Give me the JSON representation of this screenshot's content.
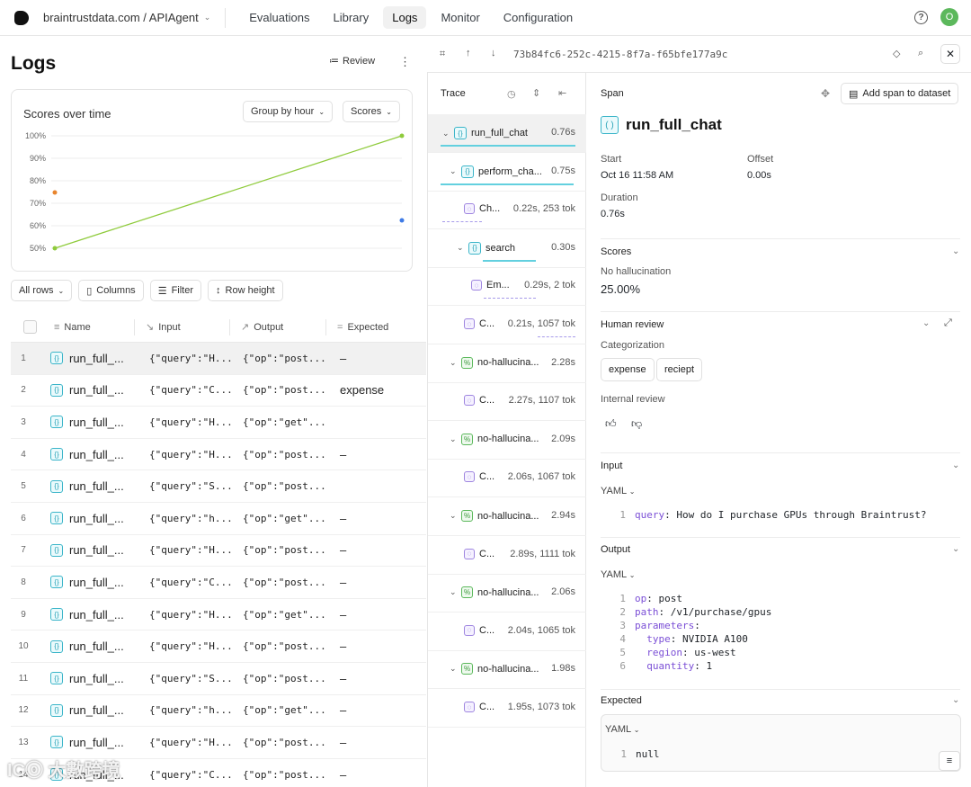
{
  "nav": {
    "project": "braintrustdata.com / APIAgent",
    "tabs": [
      "Evaluations",
      "Library",
      "Logs",
      "Monitor",
      "Configuration"
    ],
    "active_tab": "Logs",
    "avatar_initial": "O"
  },
  "logs": {
    "title": "Logs",
    "review_label": "Review",
    "chart": {
      "title": "Scores over time",
      "group_by": "Group by hour",
      "scores_chip": "Scores",
      "y_ticks": [
        "100%",
        "90%",
        "80%",
        "70%",
        "60%",
        "50%"
      ]
    },
    "toolbar": {
      "all_rows": "All rows",
      "columns": "Columns",
      "filter": "Filter",
      "row_height": "Row height"
    },
    "columns": {
      "name": "Name",
      "input": "Input",
      "output": "Output",
      "expected": "Expected"
    },
    "rows": [
      {
        "idx": "1",
        "name": "run_full_...",
        "input": "{\"query\":\"H...",
        "output": "{\"op\":\"post...",
        "expected": "–"
      },
      {
        "idx": "2",
        "name": "run_full_...",
        "input": "{\"query\":\"C...",
        "output": "{\"op\":\"post...",
        "expected": "expense"
      },
      {
        "idx": "3",
        "name": "run_full_...",
        "input": "{\"query\":\"H...",
        "output": "{\"op\":\"get\"...",
        "expected": ""
      },
      {
        "idx": "4",
        "name": "run_full_...",
        "input": "{\"query\":\"H...",
        "output": "{\"op\":\"post...",
        "expected": "–"
      },
      {
        "idx": "5",
        "name": "run_full_...",
        "input": "{\"query\":\"S...",
        "output": "{\"op\":\"post...",
        "expected": ""
      },
      {
        "idx": "6",
        "name": "run_full_...",
        "input": "{\"query\":\"h...",
        "output": "{\"op\":\"get\"...",
        "expected": "–"
      },
      {
        "idx": "7",
        "name": "run_full_...",
        "input": "{\"query\":\"H...",
        "output": "{\"op\":\"post...",
        "expected": "–"
      },
      {
        "idx": "8",
        "name": "run_full_...",
        "input": "{\"query\":\"C...",
        "output": "{\"op\":\"post...",
        "expected": "–"
      },
      {
        "idx": "9",
        "name": "run_full_...",
        "input": "{\"query\":\"H...",
        "output": "{\"op\":\"get\"...",
        "expected": "–"
      },
      {
        "idx": "10",
        "name": "run_full_...",
        "input": "{\"query\":\"H...",
        "output": "{\"op\":\"post...",
        "expected": "–"
      },
      {
        "idx": "11",
        "name": "run_full_...",
        "input": "{\"query\":\"S...",
        "output": "{\"op\":\"post...",
        "expected": "–"
      },
      {
        "idx": "12",
        "name": "run_full_...",
        "input": "{\"query\":\"h...",
        "output": "{\"op\":\"get\"...",
        "expected": "–"
      },
      {
        "idx": "13",
        "name": "run_full_...",
        "input": "{\"query\":\"H...",
        "output": "{\"op\":\"post...",
        "expected": "–"
      },
      {
        "idx": "14",
        "name": "run_full_...",
        "input": "{\"query\":\"C...",
        "output": "{\"op\":\"post...",
        "expected": "–"
      }
    ]
  },
  "trace": {
    "uuid": "73b84fc6-252c-4215-8f7a-f65bfe177a9c",
    "title": "Trace",
    "nodes": [
      {
        "label": "run_full_chat",
        "time": "0.76s"
      },
      {
        "label": "perform_cha...",
        "time": "0.75s"
      },
      {
        "label": "Ch...",
        "time": "0.22s, 253 tok"
      },
      {
        "label": "search",
        "time": "0.30s"
      },
      {
        "label": "Em...",
        "time": "0.29s, 2 tok"
      },
      {
        "label": "C...",
        "time": "0.21s, 1057 tok"
      },
      {
        "label": "no-hallucina...",
        "time": "2.28s"
      },
      {
        "label": "C...",
        "time": "2.27s, 1107 tok"
      },
      {
        "label": "no-hallucina...",
        "time": "2.09s"
      },
      {
        "label": "C...",
        "time": "2.06s, 1067 tok"
      },
      {
        "label": "no-hallucina...",
        "time": "2.94s"
      },
      {
        "label": "C...",
        "time": "2.89s, 1111 tok"
      },
      {
        "label": "no-hallucina...",
        "time": "2.06s"
      },
      {
        "label": "C...",
        "time": "2.04s, 1065 tok"
      },
      {
        "label": "no-hallucina...",
        "time": "1.98s"
      },
      {
        "label": "C...",
        "time": "1.95s, 1073 tok"
      }
    ]
  },
  "span": {
    "label": "Span",
    "add_to_dataset": "Add span to dataset",
    "name": "run_full_chat",
    "start_label": "Start",
    "start_value": "Oct 16 11:58 AM",
    "offset_label": "Offset",
    "offset_value": "0.00s",
    "duration_label": "Duration",
    "duration_value": "0.76s",
    "scores_title": "Scores",
    "score_name": "No hallucination",
    "score_value": "25.00%",
    "human_review_title": "Human review",
    "categorization_label": "Categorization",
    "tags": [
      "expense",
      "reciept"
    ],
    "internal_review_label": "Internal review",
    "input_title": "Input",
    "input_format": "YAML",
    "output_title": "Output",
    "output_format": "YAML",
    "expected_title": "Expected",
    "expected_format": "YAML",
    "input_lines": [
      {
        "n": "1",
        "k": "query",
        "v": " How do I purchase GPUs through Braintrust?"
      }
    ],
    "output_lines": [
      {
        "n": "1",
        "k": "op",
        "v": " post",
        "indent": ""
      },
      {
        "n": "2",
        "k": "path",
        "v": " /v1/purchase/gpus",
        "indent": ""
      },
      {
        "n": "3",
        "k": "parameters",
        "v": "",
        "indent": ""
      },
      {
        "n": "4",
        "k": "type",
        "v": " NVIDIA A100",
        "indent": "  "
      },
      {
        "n": "5",
        "k": "region",
        "v": " us-west",
        "indent": "  "
      },
      {
        "n": "6",
        "k": "quantity",
        "v": " 1",
        "indent": "  "
      }
    ],
    "expected_lines": [
      {
        "n": "1",
        "v": "null"
      }
    ]
  }
}
